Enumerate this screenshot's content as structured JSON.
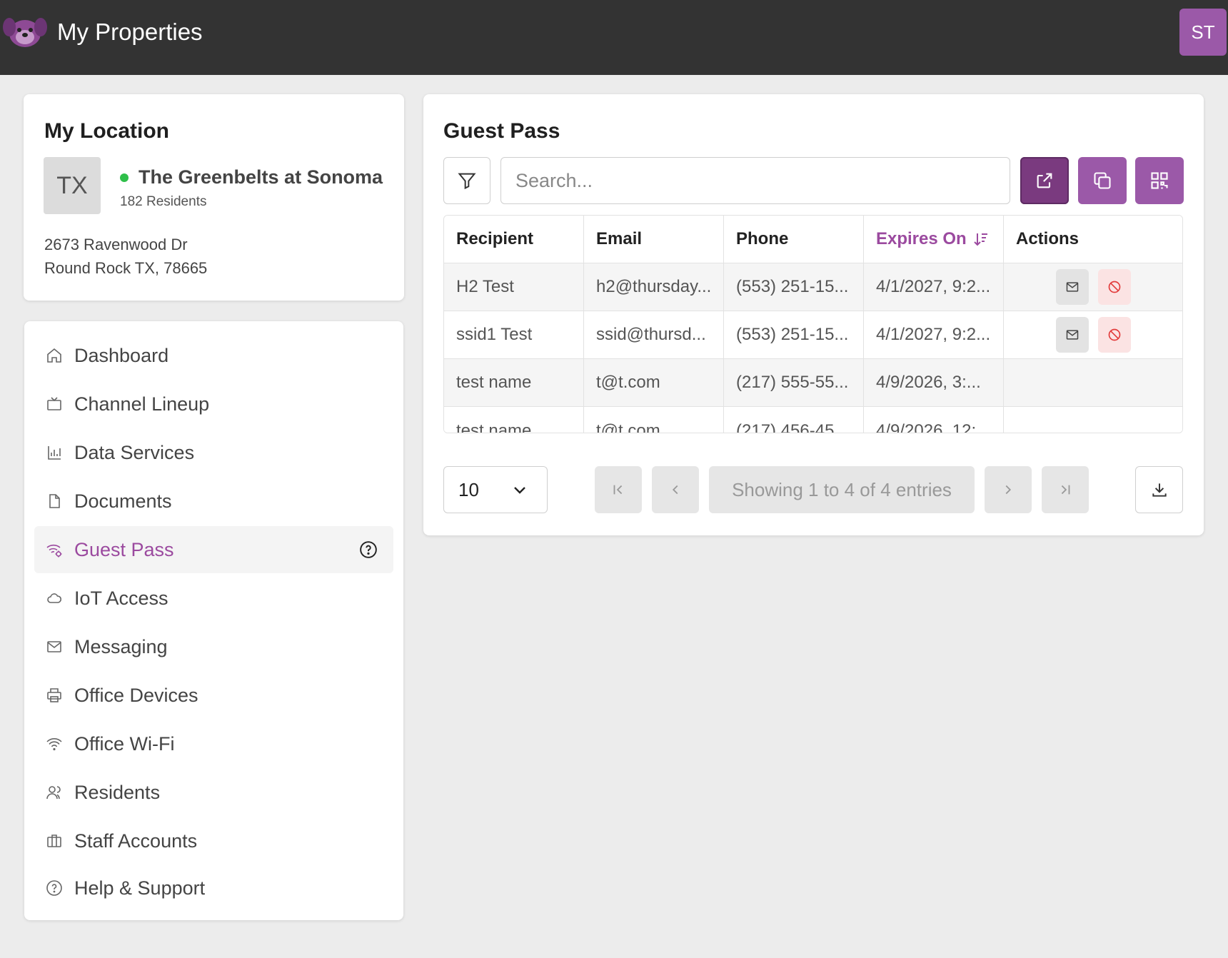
{
  "header": {
    "title": "My Properties",
    "user_initials": "ST"
  },
  "location": {
    "heading": "My Location",
    "state": "TX",
    "property_name": "The Greenbelts at Sonoma",
    "residents": "182 Residents",
    "address_line1": "2673 Ravenwood Dr",
    "address_line2": "Round Rock TX, 78665",
    "status_color": "#2fbf4a"
  },
  "nav": {
    "items": [
      {
        "label": "Dashboard",
        "icon": "home-icon"
      },
      {
        "label": "Channel Lineup",
        "icon": "tv-icon"
      },
      {
        "label": "Data Services",
        "icon": "bar-chart-icon"
      },
      {
        "label": "Documents",
        "icon": "document-icon"
      },
      {
        "label": "Guest Pass",
        "icon": "wifi-gear-icon",
        "active": true
      },
      {
        "label": "IoT Access",
        "icon": "cloud-icon"
      },
      {
        "label": "Messaging",
        "icon": "mail-icon"
      },
      {
        "label": "Office Devices",
        "icon": "printer-icon"
      },
      {
        "label": "Office Wi-Fi",
        "icon": "wifi-icon"
      },
      {
        "label": "Residents",
        "icon": "users-icon"
      },
      {
        "label": "Staff Accounts",
        "icon": "briefcase-icon"
      },
      {
        "label": "Help & Support",
        "icon": "help-icon"
      }
    ]
  },
  "guest_pass": {
    "heading": "Guest Pass",
    "search_placeholder": "Search...",
    "columns": {
      "recipient": "Recipient",
      "email": "Email",
      "phone": "Phone",
      "expires": "Expires On",
      "actions": "Actions"
    },
    "rows": [
      {
        "recipient": "H2 Test",
        "email": "h2@thursday...",
        "phone": "(553) 251-15...",
        "expires": "4/1/2027, 9:2...",
        "has_actions": true
      },
      {
        "recipient": "ssid1 Test",
        "email": "ssid@thursd...",
        "phone": "(553) 251-15...",
        "expires": "4/1/2027, 9:2...",
        "has_actions": true
      },
      {
        "recipient": "test name",
        "email": "t@t.com",
        "phone": "(217) 555-55...",
        "expires": "4/9/2026, 3:...",
        "has_actions": false
      },
      {
        "recipient": "test name",
        "email": "t@t.com",
        "phone": "(217) 456-45...",
        "expires": "4/9/2026, 12:...",
        "has_actions": false
      }
    ],
    "page_size": "10",
    "pagination_info": "Showing 1 to 4 of 4 entries",
    "accent_color": "#9b59a8",
    "accent_dark": "#7a3a7f"
  }
}
